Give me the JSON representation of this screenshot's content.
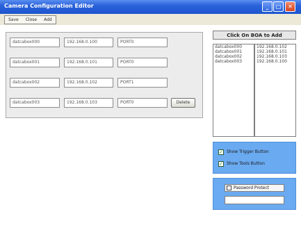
{
  "window": {
    "title": "Camera Configuration Editor",
    "minimize_glyph": "_",
    "maximize_glyph": "□",
    "close_glyph": "✕"
  },
  "menu": {
    "items": [
      {
        "label": "Save"
      },
      {
        "label": "Close"
      },
      {
        "label": "Add"
      }
    ]
  },
  "cameras": [
    {
      "name": "datcabox000",
      "ip": "192.168.0.100",
      "port": "PORT0"
    },
    {
      "name": "datcabox001",
      "ip": "192.168.0.101",
      "port": "PORT0"
    },
    {
      "name": "datcabox002",
      "ip": "192.168.0.102",
      "port": "PORT1"
    },
    {
      "name": "datcabox003",
      "ip": "192.168.0.103",
      "port": "PORT0"
    }
  ],
  "delete_label": "Delete",
  "right_panel": {
    "header": "Click On BOA to Add",
    "names": [
      "datcabox000",
      "datcabox001",
      "datcabox002",
      "datcabox003"
    ],
    "ips": [
      "192.168.0.102",
      "192.168.0.101",
      "192.168.0.103",
      "192.168.0.100"
    ]
  },
  "options": {
    "show_trigger": {
      "label": "Show Trigger Button",
      "checked": true,
      "mark": "✓"
    },
    "show_tools": {
      "label": "Show Tools Button",
      "checked": true,
      "mark": "✓"
    }
  },
  "password": {
    "label": "Password Protect",
    "checked": false,
    "value": ""
  },
  "colors": {
    "titlebar": "#2a62da",
    "panel_blue": "#6aaaf0",
    "check_green": "#1e8a1e"
  }
}
